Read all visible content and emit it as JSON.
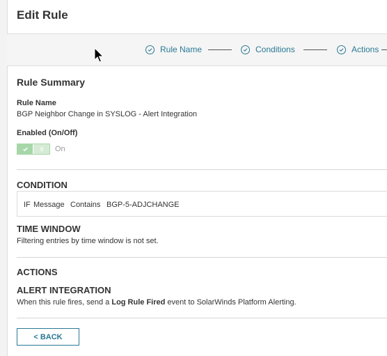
{
  "page": {
    "title": "Edit Rule"
  },
  "stepper": {
    "steps": [
      {
        "label": "Rule Name"
      },
      {
        "label": "Conditions"
      },
      {
        "label": "Actions"
      }
    ]
  },
  "summary": {
    "title": "Rule Summary",
    "rule_name_label": "Rule Name",
    "rule_name_value": "BGP Neighbor Change in SYSLOG - Alert Integration",
    "enabled_label": "Enabled (On/Off)",
    "enabled_state": "On",
    "enabled": true
  },
  "condition": {
    "heading": "CONDITION",
    "if_label": "IF",
    "field": "Message",
    "operator": "Contains",
    "value": "BGP-5-ADJCHANGE"
  },
  "time_window": {
    "heading": "TIME WINDOW",
    "text": "Filtering entries by time window is not set."
  },
  "actions": {
    "heading": "ACTIONS",
    "alert_heading": "ALERT INTEGRATION",
    "text_prefix": "When this rule fires, send a ",
    "text_bold": "Log Rule Fired",
    "text_suffix": " event to SolarWinds Platform Alerting."
  },
  "footer": {
    "back_label": "< BACK"
  },
  "colors": {
    "accent": "#297994",
    "toggle_green": "#a6d7a8"
  }
}
